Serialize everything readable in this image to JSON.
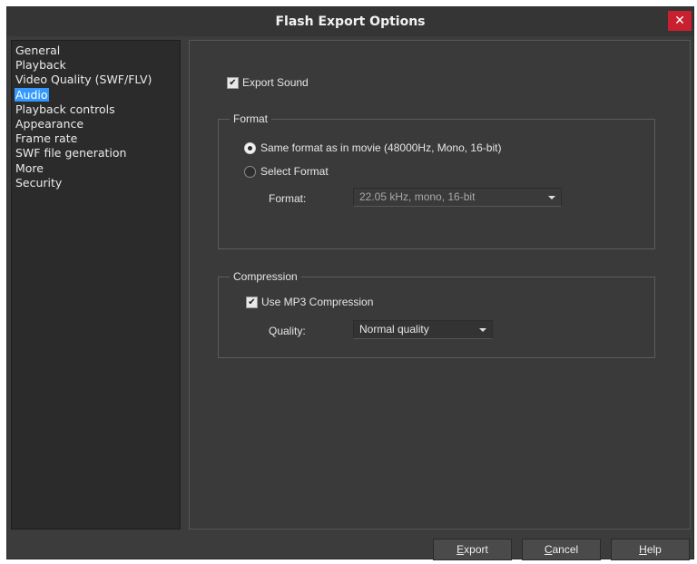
{
  "window": {
    "title": "Flash Export Options",
    "close_glyph": "✕"
  },
  "nav": {
    "items": [
      {
        "label": "General"
      },
      {
        "label": "Playback"
      },
      {
        "label": "Video Quality (SWF/FLV)"
      },
      {
        "label": "Audio",
        "selected": true
      },
      {
        "label": "Playback controls"
      },
      {
        "label": "Appearance"
      },
      {
        "label": "Frame rate"
      },
      {
        "label": "SWF file generation"
      },
      {
        "label": "More"
      },
      {
        "label": "Security"
      }
    ],
    "selected_color": "#3399ff"
  },
  "audio": {
    "export_sound": {
      "label": "Export Sound",
      "checked": true
    },
    "format_group": {
      "legend": "Format",
      "same_format_label": "Same format as in movie (48000Hz, Mono, 16-bit)",
      "same_format_selected": true,
      "select_format_label": "Select Format",
      "select_format_selected": false,
      "format_label": "Format:",
      "format_value": "22.05 kHz, mono, 16-bit"
    },
    "compression_group": {
      "legend": "Compression",
      "mp3_label": "Use MP3 Compression",
      "mp3_checked": true,
      "quality_label": "Quality:",
      "quality_value": "Normal quality"
    }
  },
  "buttons": {
    "export_mnemonic": "E",
    "export_rest": "xport",
    "cancel_mnemonic": "C",
    "cancel_rest": "ancel",
    "help_mnemonic": "H",
    "help_rest": "elp"
  },
  "icons": {
    "check": "✔",
    "close": "close-icon",
    "dropdown": "chevron-down-icon"
  },
  "colors": {
    "close_button": "#c8202e",
    "dialog_bg": "#3c3c3c"
  }
}
